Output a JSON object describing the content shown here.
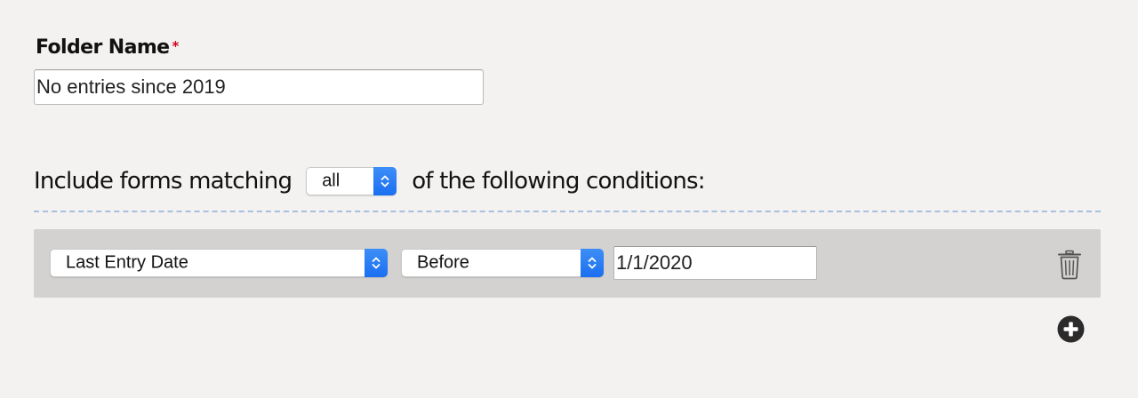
{
  "folder": {
    "label": "Folder Name",
    "required_marker": "*",
    "name_value": "No entries since 2019"
  },
  "match": {
    "prefix": "Include forms matching",
    "selected": "all",
    "suffix": "of the following conditions:"
  },
  "conditions": [
    {
      "field": "Last Entry Date",
      "operator": "Before",
      "value": "1/1/2020"
    }
  ],
  "icons": {
    "select_stepper": "chevron-up-down-icon",
    "remove_condition": "trash-icon",
    "add_condition": "plus-circle-icon"
  },
  "colors": {
    "required": "#d0021b",
    "select_accent": "#1b6ff0",
    "divider": "#a8bfe0",
    "condition_row_bg": "#d3d2d0",
    "page_bg": "#f3f2f0",
    "icon_dark": "#2b2b2b"
  }
}
